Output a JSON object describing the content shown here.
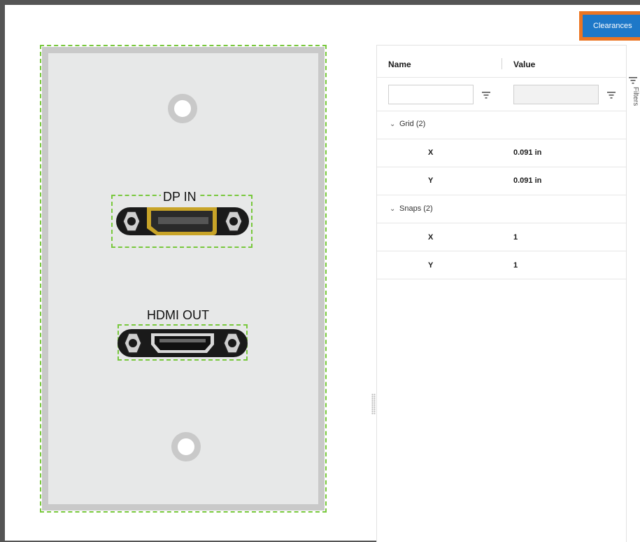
{
  "toolbar": {
    "clearances_label": "Clearances"
  },
  "plate": {
    "connectors": [
      {
        "label": "DP IN",
        "type": "displayport"
      },
      {
        "label": "HDMI OUT",
        "type": "hdmi"
      }
    ]
  },
  "grid": {
    "columns": {
      "name": "Name",
      "value": "Value"
    },
    "side_tab": "Filters",
    "groups": [
      {
        "label": "Grid (2)",
        "rows": [
          {
            "name": "X",
            "value": "0.091 in"
          },
          {
            "name": "Y",
            "value": "0.091 in"
          }
        ]
      },
      {
        "label": "Snaps (2)",
        "rows": [
          {
            "name": "X",
            "value": "1"
          },
          {
            "name": "Y",
            "value": "1"
          }
        ]
      }
    ]
  },
  "colors": {
    "accent": "#1e78c8",
    "highlight": "#ec7522",
    "selection": "#78c83c",
    "plate": "#e7e8e8"
  }
}
